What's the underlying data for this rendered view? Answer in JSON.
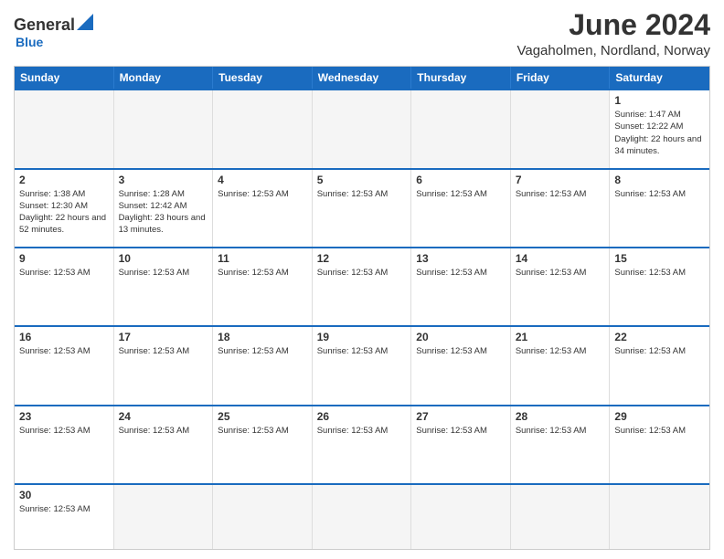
{
  "header": {
    "logo": {
      "line1": "General",
      "line2": "Blue"
    },
    "title": "June 2024",
    "location": "Vagaholmen, Nordland, Norway"
  },
  "weekdays": [
    "Sunday",
    "Monday",
    "Tuesday",
    "Wednesday",
    "Thursday",
    "Friday",
    "Saturday"
  ],
  "rows": [
    [
      {
        "day": "",
        "info": "",
        "empty": true
      },
      {
        "day": "",
        "info": "",
        "empty": true
      },
      {
        "day": "",
        "info": "",
        "empty": true
      },
      {
        "day": "",
        "info": "",
        "empty": true
      },
      {
        "day": "",
        "info": "",
        "empty": true
      },
      {
        "day": "",
        "info": "",
        "empty": true
      },
      {
        "day": "1",
        "info": "Sunrise: 1:47 AM\nSunset: 12:22 AM\nDaylight: 22 hours\nand 34 minutes.",
        "empty": false
      }
    ],
    [
      {
        "day": "2",
        "info": "Sunrise: 1:38 AM\nSunset: 12:30 AM\nDaylight: 22 hours\nand 52 minutes.",
        "empty": false
      },
      {
        "day": "3",
        "info": "Sunrise: 1:28 AM\nSunset: 12:42 AM\nDaylight: 23 hours\nand 13 minutes.",
        "empty": false
      },
      {
        "day": "4",
        "info": "Sunrise: 12:53 AM",
        "empty": false
      },
      {
        "day": "5",
        "info": "Sunrise: 12:53 AM",
        "empty": false
      },
      {
        "day": "6",
        "info": "Sunrise: 12:53 AM",
        "empty": false
      },
      {
        "day": "7",
        "info": "Sunrise: 12:53 AM",
        "empty": false
      },
      {
        "day": "8",
        "info": "Sunrise: 12:53 AM",
        "empty": false
      }
    ],
    [
      {
        "day": "9",
        "info": "Sunrise: 12:53 AM",
        "empty": false
      },
      {
        "day": "10",
        "info": "Sunrise: 12:53 AM",
        "empty": false
      },
      {
        "day": "11",
        "info": "Sunrise: 12:53 AM",
        "empty": false
      },
      {
        "day": "12",
        "info": "Sunrise: 12:53 AM",
        "empty": false
      },
      {
        "day": "13",
        "info": "Sunrise: 12:53 AM",
        "empty": false
      },
      {
        "day": "14",
        "info": "Sunrise: 12:53 AM",
        "empty": false
      },
      {
        "day": "15",
        "info": "Sunrise: 12:53 AM",
        "empty": false
      }
    ],
    [
      {
        "day": "16",
        "info": "Sunrise: 12:53 AM",
        "empty": false
      },
      {
        "day": "17",
        "info": "Sunrise: 12:53 AM",
        "empty": false
      },
      {
        "day": "18",
        "info": "Sunrise: 12:53 AM",
        "empty": false
      },
      {
        "day": "19",
        "info": "Sunrise: 12:53 AM",
        "empty": false
      },
      {
        "day": "20",
        "info": "Sunrise: 12:53 AM",
        "empty": false
      },
      {
        "day": "21",
        "info": "Sunrise: 12:53 AM",
        "empty": false
      },
      {
        "day": "22",
        "info": "Sunrise: 12:53 AM",
        "empty": false
      }
    ],
    [
      {
        "day": "23",
        "info": "Sunrise: 12:53 AM",
        "empty": false
      },
      {
        "day": "24",
        "info": "Sunrise: 12:53 AM",
        "empty": false
      },
      {
        "day": "25",
        "info": "Sunrise: 12:53 AM",
        "empty": false
      },
      {
        "day": "26",
        "info": "Sunrise: 12:53 AM",
        "empty": false
      },
      {
        "day": "27",
        "info": "Sunrise: 12:53 AM",
        "empty": false
      },
      {
        "day": "28",
        "info": "Sunrise: 12:53 AM",
        "empty": false
      },
      {
        "day": "29",
        "info": "Sunrise: 12:53 AM",
        "empty": false
      }
    ],
    [
      {
        "day": "30",
        "info": "Sunrise: 12:53 AM",
        "empty": false
      },
      {
        "day": "",
        "info": "",
        "empty": true
      },
      {
        "day": "",
        "info": "",
        "empty": true
      },
      {
        "day": "",
        "info": "",
        "empty": true
      },
      {
        "day": "",
        "info": "",
        "empty": true
      },
      {
        "day": "",
        "info": "",
        "empty": true
      },
      {
        "day": "",
        "info": "",
        "empty": true
      }
    ]
  ]
}
